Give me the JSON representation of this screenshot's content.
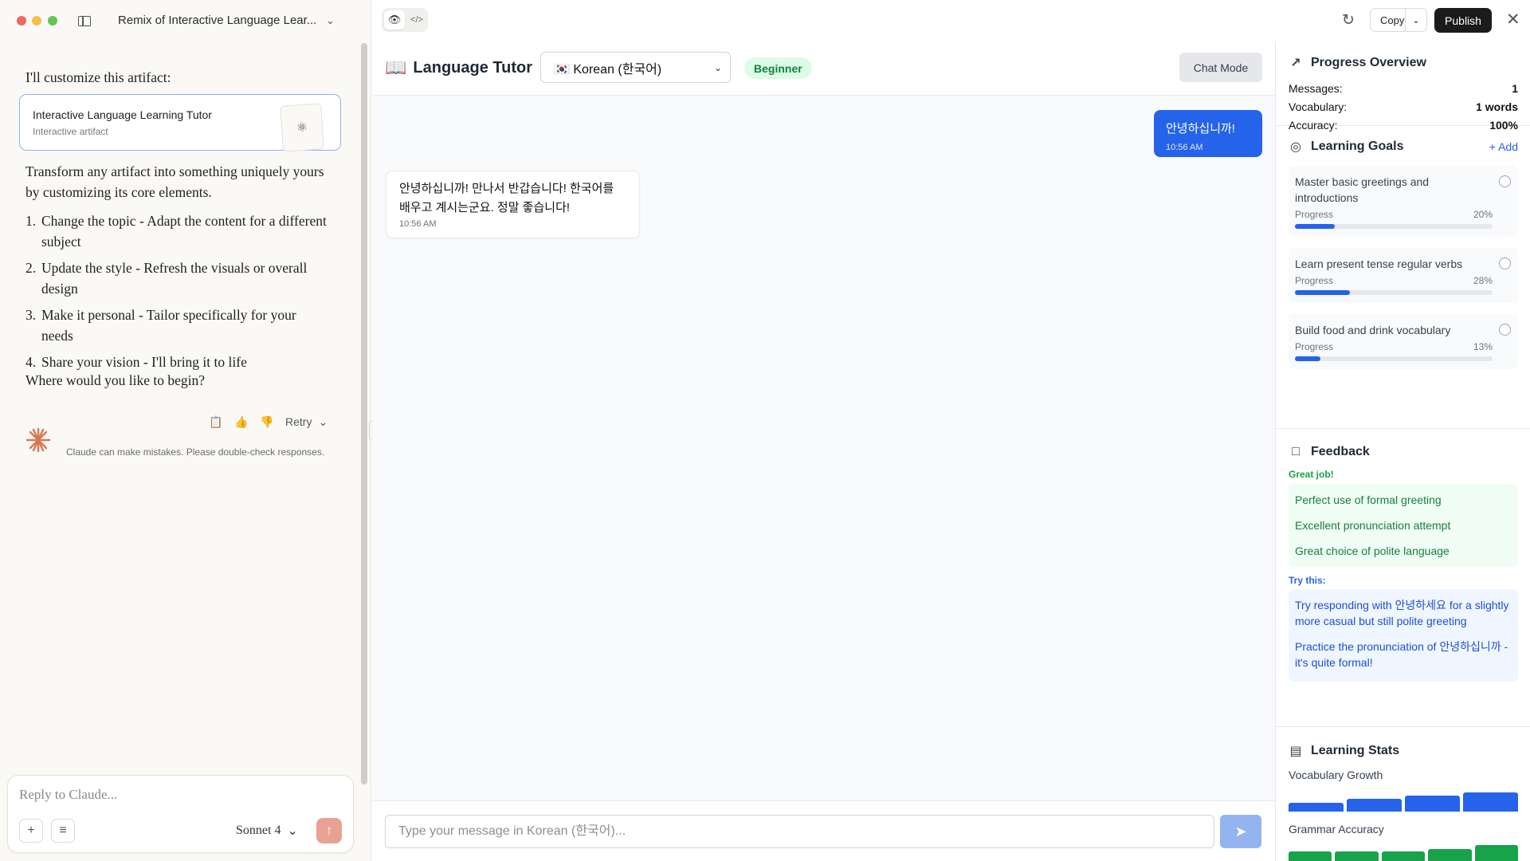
{
  "window": {
    "conversation_title": "Remix of Interactive Language Lear..."
  },
  "assistant": {
    "lead": "I'll customize this artifact:",
    "artifact_card": {
      "title": "Interactive Language Learning Tutor",
      "subtitle": "Interactive artifact"
    },
    "intro": "Transform any artifact into something uniquely yours by customizing its core elements.",
    "steps": [
      {
        "num": "1.",
        "text": "Change the topic - Adapt the content for a different subject"
      },
      {
        "num": "2.",
        "text": "Update the style - Refresh the visuals or overall design"
      },
      {
        "num": "3.",
        "text": "Make it personal - Tailor specifically for your needs"
      },
      {
        "num": "4.",
        "text": "Share your vision - I'll bring it to life"
      }
    ],
    "closing": "Where would you like to begin?",
    "retry_label": "Retry",
    "disclaimer": "Claude can make mistakes. Please double-check responses."
  },
  "composer": {
    "placeholder": "Reply to Claude...",
    "model": "Sonnet 4"
  },
  "artifact_toolbar": {
    "copy_label": "Copy",
    "publish_label": "Publish"
  },
  "tutor": {
    "app_title": "Language Tutor",
    "language": "🇰🇷 Korean (한국어)",
    "level": "Beginner",
    "chat_mode_label": "Chat Mode",
    "messages": [
      {
        "role": "user",
        "text": "안녕하십니까!",
        "time": "10:56 AM"
      },
      {
        "role": "assistant",
        "text": "안녕하십니까! 만나서 반갑습니다! 한국어를 배우고 계시는군요. 정말 좋습니다!",
        "time": "10:56 AM"
      }
    ],
    "input_placeholder": "Type your message in Korean (한국어)..."
  },
  "sidebar": {
    "progress": {
      "title": "Progress Overview",
      "rows": [
        {
          "label": "Messages:",
          "value": "1"
        },
        {
          "label": "Vocabulary:",
          "value": "1 words"
        },
        {
          "label": "Accuracy:",
          "value": "100%"
        }
      ]
    },
    "goals": {
      "title": "Learning Goals",
      "add_label": "+ Add",
      "progress_label": "Progress",
      "items": [
        {
          "title": "Master basic greetings and introductions",
          "percent_label": "20%",
          "percent": 20
        },
        {
          "title": "Learn present tense regular verbs",
          "percent_label": "28%",
          "percent": 28
        },
        {
          "title": "Build food and drink vocabulary",
          "percent_label": "13%",
          "percent": 13
        }
      ]
    },
    "feedback": {
      "title": "Feedback",
      "good_label": "Great job!",
      "good_items": [
        "Perfect use of formal greeting",
        "Excellent pronunciation attempt",
        "Great choice of polite language"
      ],
      "try_label": "Try this:",
      "try_items": [
        "Try responding with 안녕하세요 for a slightly more casual but still polite greeting",
        "Practice the pronunciation of 안녕하십니까 - it's quite formal!"
      ]
    },
    "stats": {
      "title": "Learning Stats",
      "vocab_label": "Vocabulary Growth",
      "grammar_label": "Grammar Accuracy",
      "vocab_levels": [
        0.45,
        0.65,
        0.85,
        1.0
      ],
      "grammar_levels": [
        0.7,
        0.7,
        0.7,
        0.8,
        1.0
      ],
      "colors": {
        "vocab": "#2563eb",
        "grammar": "#16a34a"
      }
    }
  }
}
